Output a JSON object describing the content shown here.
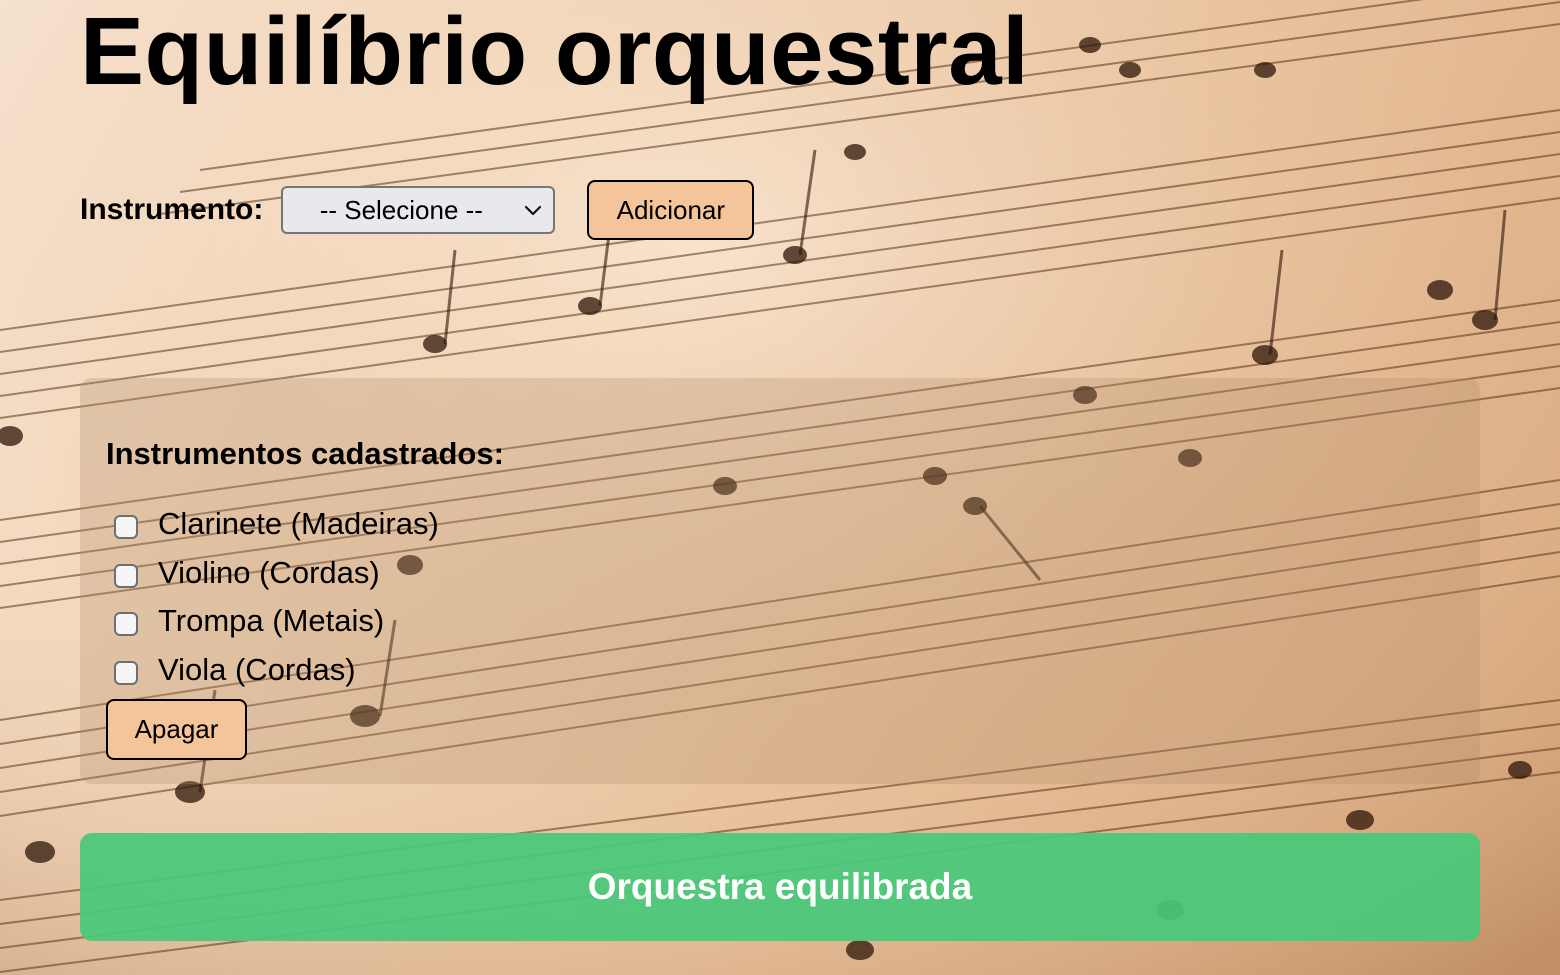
{
  "page": {
    "title": "Equilíbrio orquestral"
  },
  "form": {
    "label": "Instrumento:",
    "select_value": "-- Selecione --",
    "add_button": "Adicionar"
  },
  "registered": {
    "title": "Instrumentos cadastrados:",
    "items": [
      {
        "label": "Clarinete (Madeiras)",
        "checked": false
      },
      {
        "label": "Violino (Cordas)",
        "checked": false
      },
      {
        "label": "Trompa (Metais)",
        "checked": false
      },
      {
        "label": "Viola (Cordas)",
        "checked": false
      }
    ],
    "clear_button": "Apagar"
  },
  "result": {
    "text": "Orquestra equilibrada",
    "color": "#48c87a"
  },
  "theme": {
    "button_color": "#f4c49a",
    "background_image": "sheet-music"
  }
}
